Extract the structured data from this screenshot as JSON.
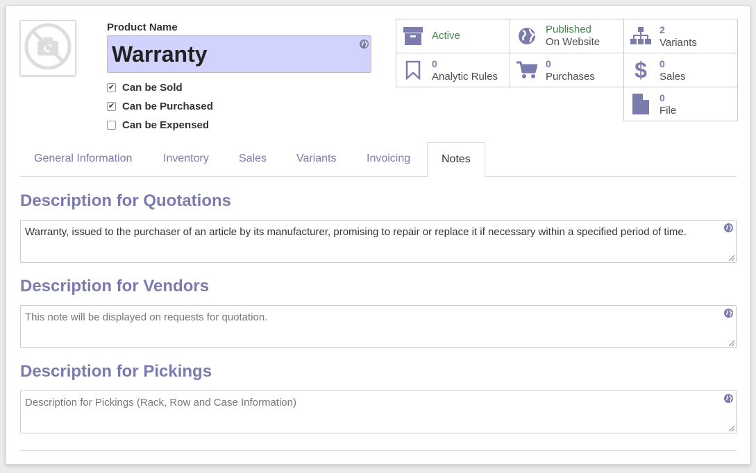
{
  "product": {
    "name_label": "Product Name",
    "name": "Warranty",
    "image_icon": "no-camera-icon"
  },
  "flags": [
    {
      "label": "Can be Sold",
      "checked": true
    },
    {
      "label": "Can be Purchased",
      "checked": true
    },
    {
      "label": "Can be Expensed",
      "checked": false
    }
  ],
  "smart_buttons": {
    "active": {
      "label": "Active",
      "icon": "archive-icon"
    },
    "website": {
      "line1": "Published",
      "line2": "On Website",
      "icon": "globe-icon"
    },
    "variants": {
      "count": "2",
      "label": "Variants",
      "icon": "sitemap-icon"
    },
    "analytic": {
      "count": "0",
      "label": "Analytic Rules",
      "icon": "bookmark-icon"
    },
    "purchases": {
      "count": "0",
      "label": "Purchases",
      "icon": "cart-icon"
    },
    "sales": {
      "count": "0",
      "label": "Sales",
      "icon": "dollar-icon"
    },
    "file": {
      "count": "0",
      "label": "File",
      "icon": "file-icon"
    }
  },
  "tabs": [
    {
      "label": "General Information"
    },
    {
      "label": "Inventory"
    },
    {
      "label": "Sales"
    },
    {
      "label": "Variants"
    },
    {
      "label": "Invoicing"
    },
    {
      "label": "Notes",
      "active": true
    }
  ],
  "notes": {
    "quotations": {
      "title": "Description for Quotations",
      "value": "Warranty, issued to the purchaser of an article by its manufacturer, promising to repair or replace it if necessary within a specified period of time."
    },
    "vendors": {
      "title": "Description for Vendors",
      "placeholder": "This note will be displayed on requests for quotation."
    },
    "pickings": {
      "title": "Description for Pickings",
      "placeholder": "Description for Pickings (Rack, Row and Case Information)"
    }
  },
  "colors": {
    "accent": "#7c7bad",
    "active_green": "#44864a",
    "name_field_bg": "#d2d2ff"
  }
}
